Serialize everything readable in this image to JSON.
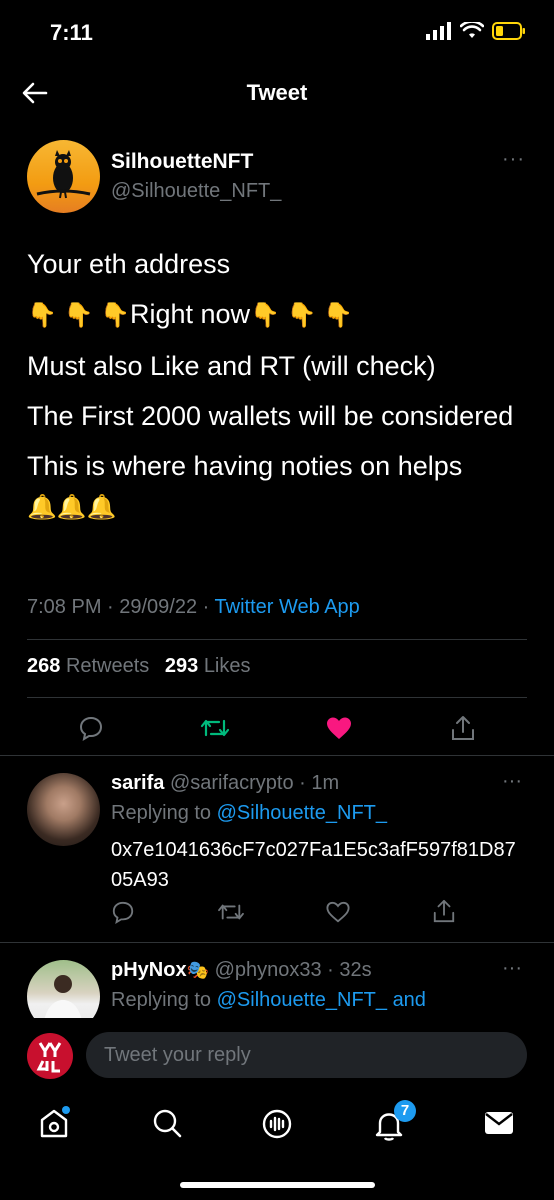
{
  "status": {
    "time": "7:11"
  },
  "header": {
    "title": "Tweet"
  },
  "tweet": {
    "author_name": "SilhouetteNFT",
    "author_handle": "@Silhouette_NFT_",
    "lines": [
      "Your eth address",
      "Right now",
      "Must also Like and RT (will check)",
      "The First 2000 wallets will be considered",
      "This is where having noties on helps"
    ],
    "meta_time": "7:08 PM · 29/09/22 · ",
    "meta_source": "Twitter Web App",
    "retweets_count": "268",
    "retweets_label": "Retweets",
    "likes_count": "293",
    "likes_label": "Likes"
  },
  "replies": [
    {
      "name": "sarifa",
      "handle": "@sarifacrypto · 1m",
      "replying_prefix": "Replying to ",
      "replying_to": "@Silhouette_NFT_",
      "text": "0x7e1041636cF7c027Fa1E5c3afF597f81D8705A93"
    },
    {
      "name": "pHyNox",
      "handle": "@phynox33 · 32s",
      "replying_prefix": "Replying to ",
      "replying_to": "@Silhouette_NFT_ and"
    }
  ],
  "compose": {
    "placeholder": "Tweet your reply"
  },
  "tabbar": {
    "notifications_badge": "7"
  },
  "colors": {
    "accent": "#1d9bf0",
    "like": "#f91880",
    "retweet": "#00ba7c"
  }
}
